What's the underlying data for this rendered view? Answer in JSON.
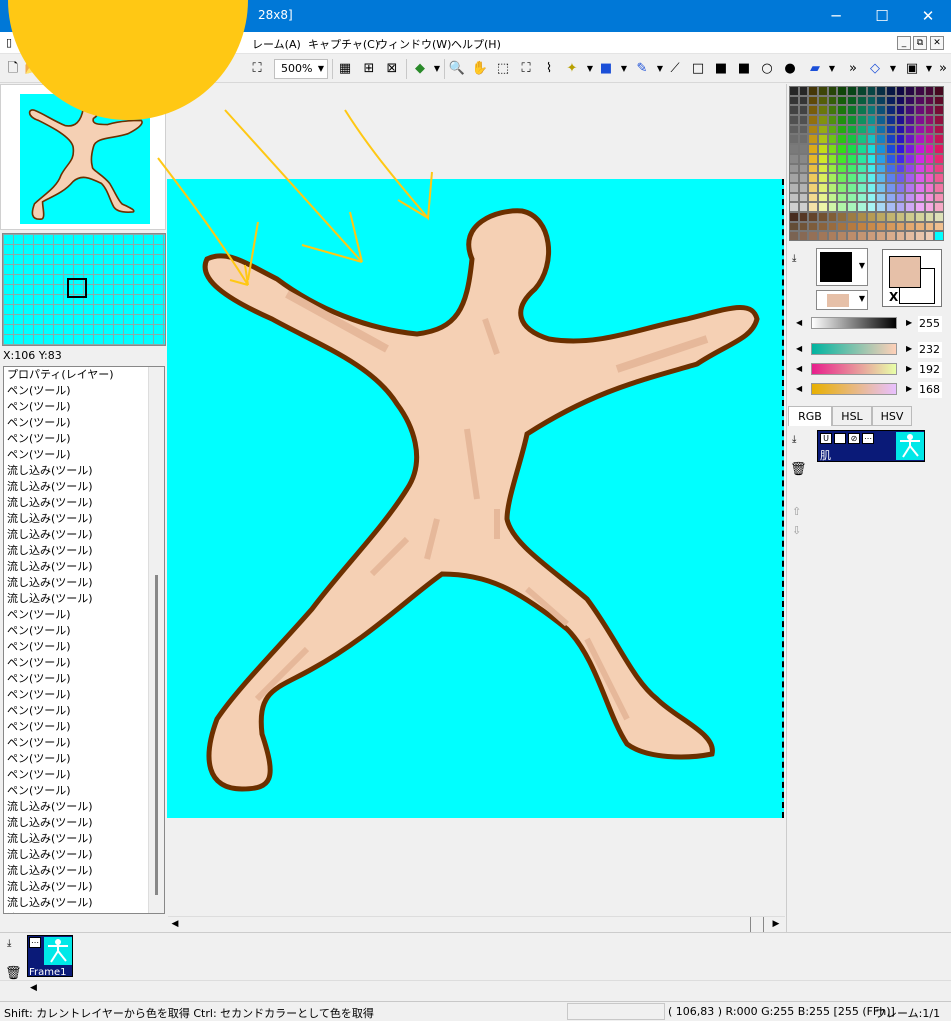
{
  "window": {
    "title_fragment": "28x8]",
    "controls": [
      "─",
      "☐",
      "✕"
    ]
  },
  "menu": {
    "items": [
      "レーム(A)",
      "キャプチャ(C)",
      "ウィンドウ(W)",
      "ヘルプ(H)"
    ],
    "mdi": [
      "_",
      "⧉",
      "✕"
    ]
  },
  "toolbar": {
    "zoom": "500%"
  },
  "navigator": {
    "coord": "X:106 Y:83"
  },
  "history": {
    "items": [
      "プロパティ(レイヤー)",
      "ペン(ツール)",
      "ペン(ツール)",
      "ペン(ツール)",
      "ペン(ツール)",
      "ペン(ツール)",
      "流し込み(ツール)",
      "流し込み(ツール)",
      "流し込み(ツール)",
      "流し込み(ツール)",
      "流し込み(ツール)",
      "流し込み(ツール)",
      "流し込み(ツール)",
      "流し込み(ツール)",
      "流し込み(ツール)",
      "ペン(ツール)",
      "ペン(ツール)",
      "ペン(ツール)",
      "ペン(ツール)",
      "ペン(ツール)",
      "ペン(ツール)",
      "ペン(ツール)",
      "ペン(ツール)",
      "ペン(ツール)",
      "ペン(ツール)",
      "ペン(ツール)",
      "ペン(ツール)",
      "流し込み(ツール)",
      "流し込み(ツール)",
      "流し込み(ツール)",
      "流し込み(ツール)",
      "流し込み(ツール)",
      "流し込み(ツール)",
      "流し込み(ツール)",
      "流し込み(ツール)",
      "流し込み(ツール)"
    ]
  },
  "colors": {
    "canvas_bg": "#00ffff",
    "skin": "#f5d0b4",
    "skin_shade": "#e6b89a",
    "outline": "#6b3000",
    "primary": "#000000",
    "secondary": "#e6c0a8",
    "arrow": "#ffc814"
  },
  "sliders": {
    "gray": "255",
    "r": "232",
    "g": "192",
    "b": "168"
  },
  "tabs": [
    "RGB",
    "HSL",
    "HSV"
  ],
  "layer": {
    "name": "肌"
  },
  "frame": {
    "name": "Frame1"
  },
  "status": {
    "hint": "Shift: カレントレイヤーから色を取得 Ctrl: セカンドカラーとして色を取得",
    "pixel": "( 106,83 ) R:000 G:255 B:255 [255 (FFh)]",
    "frame": "フレーム:1/1"
  }
}
